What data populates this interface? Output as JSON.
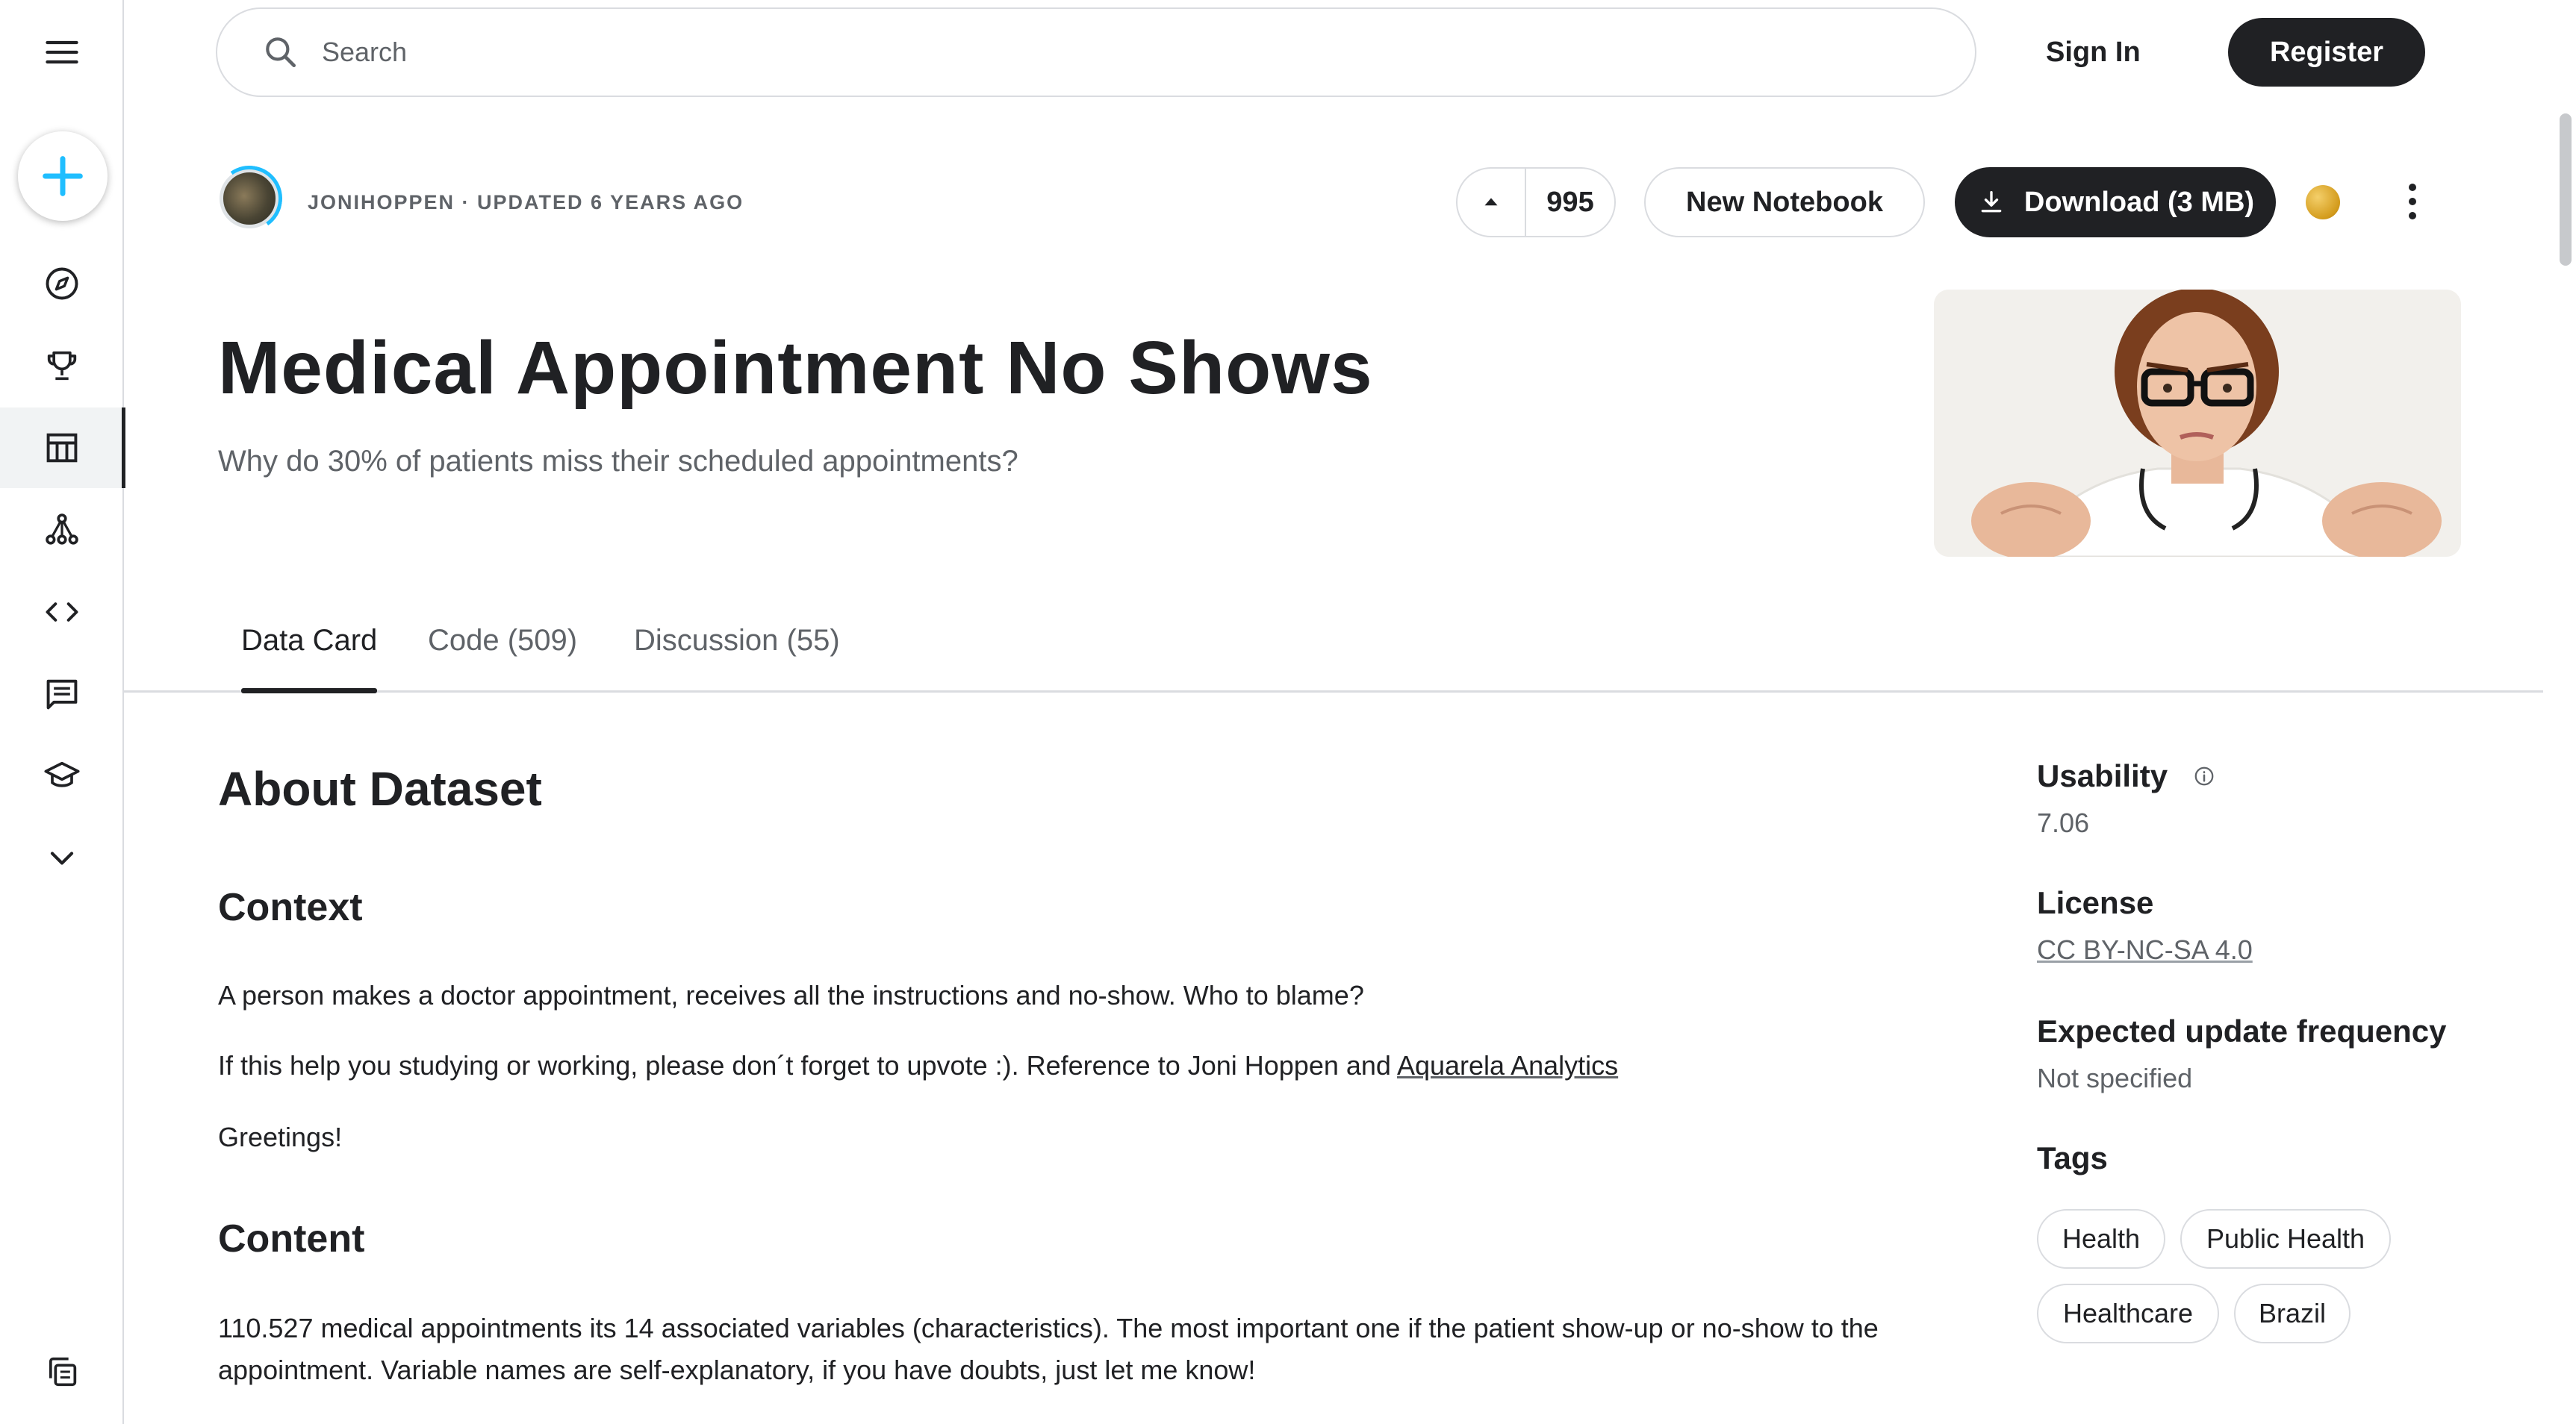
{
  "header": {
    "search_placeholder": "Search",
    "sign_in": "Sign In",
    "register": "Register"
  },
  "sidebar": {
    "items": [
      {
        "icon": "menu-icon"
      },
      {
        "icon": "plus-icon"
      },
      {
        "icon": "compass-icon"
      },
      {
        "icon": "trophy-icon"
      },
      {
        "icon": "table-icon",
        "active": true
      },
      {
        "icon": "model-icon"
      },
      {
        "icon": "code-icon"
      },
      {
        "icon": "discussion-icon"
      },
      {
        "icon": "school-icon"
      },
      {
        "icon": "chevron-down-icon"
      },
      {
        "icon": "copy-icon"
      }
    ]
  },
  "dataset": {
    "owner_meta": "JONIHOPPEN · UPDATED 6 YEARS AGO",
    "votes": "995",
    "new_notebook": "New Notebook",
    "download": "Download (3 MB)",
    "title": "Medical Appointment No Shows",
    "subtitle": "Why do 30% of patients miss their scheduled appointments?"
  },
  "tabs": [
    {
      "label": "Data Card",
      "active": true
    },
    {
      "label": "Code (509)",
      "active": false
    },
    {
      "label": "Discussion (55)",
      "active": false
    }
  ],
  "about": {
    "heading": "About Dataset",
    "context_heading": "Context",
    "context_p1": "A person makes a doctor appointment, receives all the instructions and no-show. Who to blame?",
    "context_p2_text": "If this help you studying or working, please don´t forget to upvote :). Reference to Joni Hoppen and ",
    "context_p2_link": "Aquarela Analytics",
    "context_p3": "Greetings!",
    "content_heading": "Content",
    "content_p1": "110.527 medical appointments its 14 associated variables (characteristics). The most important one if the patient show-up or no-show to the",
    "content_p2": "appointment. Variable names are self-explanatory, if you have doubts, just let me know!"
  },
  "side": {
    "usability_label": "Usability",
    "usability_value": "7.06",
    "license_label": "License",
    "license_value": "CC BY-NC-SA 4.0",
    "update_label": "Expected update frequency",
    "update_value": "Not specified",
    "tags_label": "Tags",
    "tags": [
      "Health",
      "Public Health",
      "Healthcare",
      "Brazil"
    ]
  },
  "colors": {
    "accent_blue": "#20beff",
    "primary_dark": "#202124",
    "muted_text": "#5f6368",
    "border": "#dadce0"
  }
}
